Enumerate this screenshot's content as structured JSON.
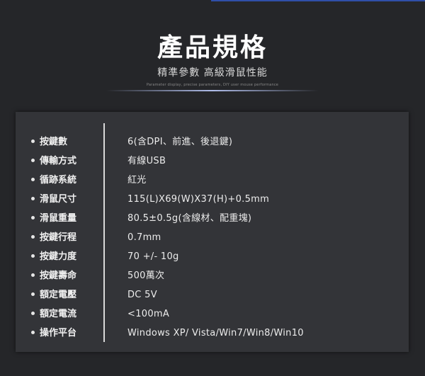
{
  "header": {
    "title": "產品規格",
    "subtitle": "精準參數 高級滑鼠性能",
    "tagline": "Parameter display, precise parameters, DIY user mouse performance"
  },
  "specs": [
    {
      "label": "按鍵數",
      "value": "6(含DPI、前進、後退鍵)"
    },
    {
      "label": "傳輸方式",
      "value": "有線USB"
    },
    {
      "label": "循跡系統",
      "value": "紅光"
    },
    {
      "label": "滑鼠尺寸",
      "value": "115(L)X69(W)X37(H)+0.5mm"
    },
    {
      "label": "滑鼠重量",
      "value": "80.5±0.5g(含線材、配重塊)"
    },
    {
      "label": "按鍵行程",
      "value": "0.7mm"
    },
    {
      "label": "按鍵力度",
      "value": "70 +/- 10g"
    },
    {
      "label": "按鍵壽命",
      "value": "500萬次"
    },
    {
      "label": "額定電壓",
      "value": "DC 5V"
    },
    {
      "label": "額定電流",
      "value": "<100mA"
    },
    {
      "label": "操作平台",
      "value": "Windows XP/ Vista/Win7/Win8/Win10"
    }
  ]
}
